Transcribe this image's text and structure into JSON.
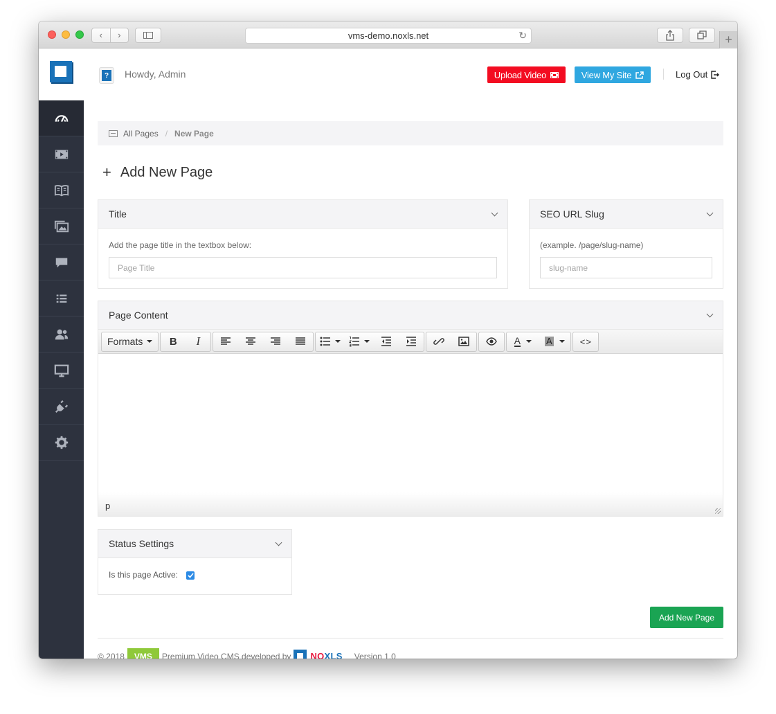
{
  "browser": {
    "url": "vms-demo.noxls.net",
    "back_glyph": "‹",
    "forward_glyph": "›",
    "new_tab_glyph": "+"
  },
  "sidebar": {
    "items": [
      {
        "icon": "dashboard-gauge-icon",
        "active": true
      },
      {
        "icon": "video-film-icon"
      },
      {
        "icon": "pages-book-icon"
      },
      {
        "icon": "gallery-images-icon"
      },
      {
        "icon": "comments-icon"
      },
      {
        "icon": "list-icon"
      },
      {
        "icon": "users-icon"
      },
      {
        "icon": "monitor-icon"
      },
      {
        "icon": "plugin-icon"
      },
      {
        "icon": "settings-gear-icon"
      }
    ]
  },
  "header": {
    "avatar_glyph": "?",
    "greeting": "Howdy, Admin",
    "upload_label": "Upload Video",
    "view_site_label": "View My Site",
    "logout_label": "Log Out"
  },
  "breadcrumb": {
    "root": "All Pages",
    "separator": "/",
    "current": "New Page"
  },
  "page": {
    "title_prefix": "+",
    "title": "Add New Page"
  },
  "title_panel": {
    "heading": "Title",
    "help": "Add the page title in the textbox below:",
    "placeholder": "Page Title",
    "value": ""
  },
  "slug_panel": {
    "heading": "SEO URL Slug",
    "help": "(example. /page/slug-name)",
    "placeholder": "slug-name",
    "value": ""
  },
  "content_panel": {
    "heading": "Page Content",
    "formats_label": "Formats",
    "bold_glyph": "B",
    "italic_glyph": "I",
    "text_color_glyph": "A",
    "bg_color_glyph": "A",
    "code_glyph": "<>",
    "status_path": "p"
  },
  "status_panel": {
    "heading": "Status Settings",
    "active_label": "Is this page Active:",
    "active_checked": true
  },
  "actions": {
    "submit_label": "Add New Page"
  },
  "footer": {
    "copyright": "© 2018",
    "badge": "VMS",
    "tagline": "Premium Video CMS developed by",
    "brand_prefix": "NO",
    "brand_suffix": "XLS",
    "version": "Version 1.0"
  },
  "colors": {
    "sidebar_bg": "#2d323e",
    "upload_red": "#f30c21",
    "site_blue": "#2fa7e0",
    "submit_green": "#1aa453",
    "vms_green": "#8fc93a",
    "brand_red": "#e8173d",
    "brand_blue": "#1a72b8"
  }
}
